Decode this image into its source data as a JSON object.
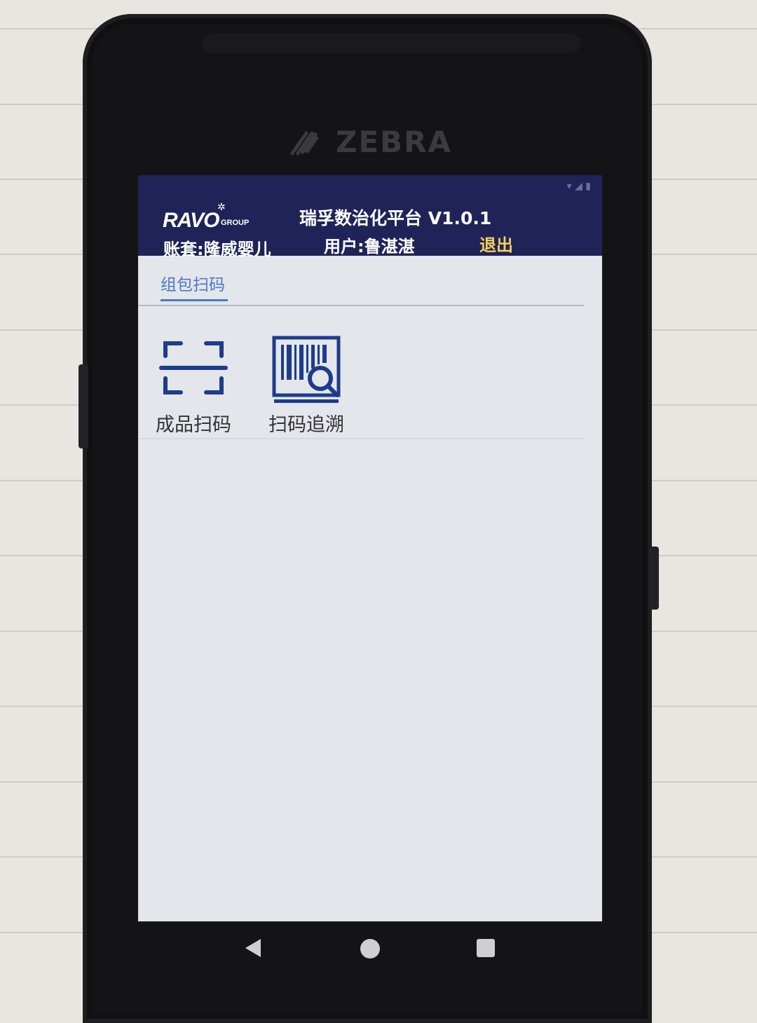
{
  "device": {
    "brand": "ZEBRA"
  },
  "header": {
    "logo_text": "RAVO",
    "logo_sub": "GROUP",
    "title": "瑞孚数治化平台 V1.0.1",
    "account": "账套:隆威婴儿",
    "user": "用户:鲁湛湛",
    "logout_label": "退出"
  },
  "tabs": [
    {
      "label": "组包扫码",
      "active": true
    }
  ],
  "tiles": [
    {
      "label": "成品扫码",
      "icon": "scan-frame-icon"
    },
    {
      "label": "扫码追溯",
      "icon": "barcode-search-icon"
    }
  ],
  "navbar": {
    "icons": [
      "back-icon",
      "home-icon",
      "recents-icon"
    ]
  },
  "colors": {
    "header_bg": "#1f2357",
    "accent": "#4c78c9",
    "logout": "#f4cf5a",
    "icon_blue": "#1e3c8c"
  }
}
